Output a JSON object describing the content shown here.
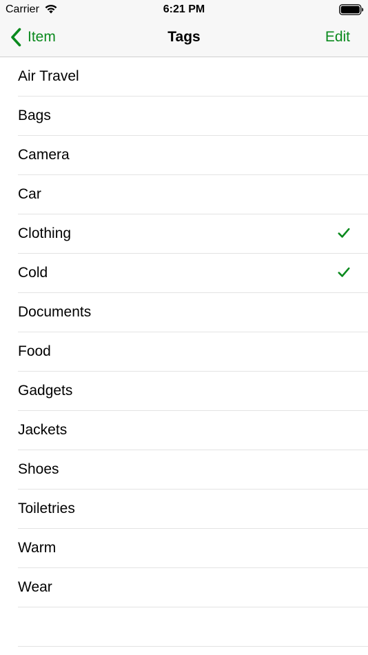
{
  "status_bar": {
    "carrier": "Carrier",
    "time": "6:21 PM"
  },
  "nav": {
    "back_label": "Item",
    "title": "Tags",
    "edit_label": "Edit"
  },
  "colors": {
    "accent": "#0b8a1e",
    "separator": "#e3e3e3",
    "bar_background": "#f7f7f7"
  },
  "icons": {
    "wifi": "wifi-icon",
    "battery": "battery-icon",
    "back": "chevron-left-icon",
    "check": "checkmark-icon"
  },
  "tags": [
    {
      "label": "Air Travel",
      "checked": false
    },
    {
      "label": "Bags",
      "checked": false
    },
    {
      "label": "Camera",
      "checked": false
    },
    {
      "label": "Car",
      "checked": false
    },
    {
      "label": "Clothing",
      "checked": true
    },
    {
      "label": "Cold",
      "checked": true
    },
    {
      "label": "Documents",
      "checked": false
    },
    {
      "label": "Food",
      "checked": false
    },
    {
      "label": "Gadgets",
      "checked": false
    },
    {
      "label": "Jackets",
      "checked": false
    },
    {
      "label": "Shoes",
      "checked": false
    },
    {
      "label": "Toiletries",
      "checked": false
    },
    {
      "label": "Warm",
      "checked": false
    },
    {
      "label": "Wear",
      "checked": false
    }
  ]
}
